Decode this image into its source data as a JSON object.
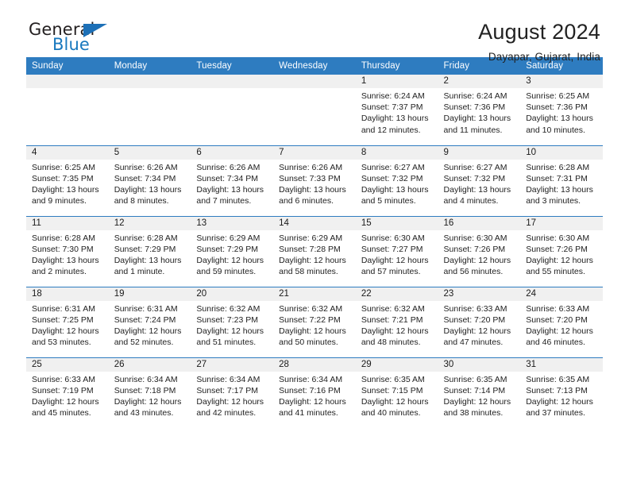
{
  "brand": {
    "line1": "General",
    "line2": "Blue",
    "accent_color": "#1d70b7"
  },
  "header": {
    "title": "August 2024",
    "subtitle": "Dayapar, Gujarat, India"
  },
  "theme": {
    "header_bg": "#2e7cc0",
    "daynum_bg": "#f0f0f0",
    "text": "#222222"
  },
  "weekdays": [
    "Sunday",
    "Monday",
    "Tuesday",
    "Wednesday",
    "Thursday",
    "Friday",
    "Saturday"
  ],
  "labels": {
    "sunrise": "Sunrise:",
    "sunset": "Sunset:",
    "daylight": "Daylight:"
  },
  "weeks": [
    [
      {
        "day": "",
        "sunrise": "",
        "sunset": "",
        "daylight_l1": "",
        "daylight_l2": ""
      },
      {
        "day": "",
        "sunrise": "",
        "sunset": "",
        "daylight_l1": "",
        "daylight_l2": ""
      },
      {
        "day": "",
        "sunrise": "",
        "sunset": "",
        "daylight_l1": "",
        "daylight_l2": ""
      },
      {
        "day": "",
        "sunrise": "",
        "sunset": "",
        "daylight_l1": "",
        "daylight_l2": ""
      },
      {
        "day": "1",
        "sunrise": "Sunrise: 6:24 AM",
        "sunset": "Sunset: 7:37 PM",
        "daylight_l1": "Daylight: 13 hours",
        "daylight_l2": "and 12 minutes."
      },
      {
        "day": "2",
        "sunrise": "Sunrise: 6:24 AM",
        "sunset": "Sunset: 7:36 PM",
        "daylight_l1": "Daylight: 13 hours",
        "daylight_l2": "and 11 minutes."
      },
      {
        "day": "3",
        "sunrise": "Sunrise: 6:25 AM",
        "sunset": "Sunset: 7:36 PM",
        "daylight_l1": "Daylight: 13 hours",
        "daylight_l2": "and 10 minutes."
      }
    ],
    [
      {
        "day": "4",
        "sunrise": "Sunrise: 6:25 AM",
        "sunset": "Sunset: 7:35 PM",
        "daylight_l1": "Daylight: 13 hours",
        "daylight_l2": "and 9 minutes."
      },
      {
        "day": "5",
        "sunrise": "Sunrise: 6:26 AM",
        "sunset": "Sunset: 7:34 PM",
        "daylight_l1": "Daylight: 13 hours",
        "daylight_l2": "and 8 minutes."
      },
      {
        "day": "6",
        "sunrise": "Sunrise: 6:26 AM",
        "sunset": "Sunset: 7:34 PM",
        "daylight_l1": "Daylight: 13 hours",
        "daylight_l2": "and 7 minutes."
      },
      {
        "day": "7",
        "sunrise": "Sunrise: 6:26 AM",
        "sunset": "Sunset: 7:33 PM",
        "daylight_l1": "Daylight: 13 hours",
        "daylight_l2": "and 6 minutes."
      },
      {
        "day": "8",
        "sunrise": "Sunrise: 6:27 AM",
        "sunset": "Sunset: 7:32 PM",
        "daylight_l1": "Daylight: 13 hours",
        "daylight_l2": "and 5 minutes."
      },
      {
        "day": "9",
        "sunrise": "Sunrise: 6:27 AM",
        "sunset": "Sunset: 7:32 PM",
        "daylight_l1": "Daylight: 13 hours",
        "daylight_l2": "and 4 minutes."
      },
      {
        "day": "10",
        "sunrise": "Sunrise: 6:28 AM",
        "sunset": "Sunset: 7:31 PM",
        "daylight_l1": "Daylight: 13 hours",
        "daylight_l2": "and 3 minutes."
      }
    ],
    [
      {
        "day": "11",
        "sunrise": "Sunrise: 6:28 AM",
        "sunset": "Sunset: 7:30 PM",
        "daylight_l1": "Daylight: 13 hours",
        "daylight_l2": "and 2 minutes."
      },
      {
        "day": "12",
        "sunrise": "Sunrise: 6:28 AM",
        "sunset": "Sunset: 7:29 PM",
        "daylight_l1": "Daylight: 13 hours",
        "daylight_l2": "and 1 minute."
      },
      {
        "day": "13",
        "sunrise": "Sunrise: 6:29 AM",
        "sunset": "Sunset: 7:29 PM",
        "daylight_l1": "Daylight: 12 hours",
        "daylight_l2": "and 59 minutes."
      },
      {
        "day": "14",
        "sunrise": "Sunrise: 6:29 AM",
        "sunset": "Sunset: 7:28 PM",
        "daylight_l1": "Daylight: 12 hours",
        "daylight_l2": "and 58 minutes."
      },
      {
        "day": "15",
        "sunrise": "Sunrise: 6:30 AM",
        "sunset": "Sunset: 7:27 PM",
        "daylight_l1": "Daylight: 12 hours",
        "daylight_l2": "and 57 minutes."
      },
      {
        "day": "16",
        "sunrise": "Sunrise: 6:30 AM",
        "sunset": "Sunset: 7:26 PM",
        "daylight_l1": "Daylight: 12 hours",
        "daylight_l2": "and 56 minutes."
      },
      {
        "day": "17",
        "sunrise": "Sunrise: 6:30 AM",
        "sunset": "Sunset: 7:26 PM",
        "daylight_l1": "Daylight: 12 hours",
        "daylight_l2": "and 55 minutes."
      }
    ],
    [
      {
        "day": "18",
        "sunrise": "Sunrise: 6:31 AM",
        "sunset": "Sunset: 7:25 PM",
        "daylight_l1": "Daylight: 12 hours",
        "daylight_l2": "and 53 minutes."
      },
      {
        "day": "19",
        "sunrise": "Sunrise: 6:31 AM",
        "sunset": "Sunset: 7:24 PM",
        "daylight_l1": "Daylight: 12 hours",
        "daylight_l2": "and 52 minutes."
      },
      {
        "day": "20",
        "sunrise": "Sunrise: 6:32 AM",
        "sunset": "Sunset: 7:23 PM",
        "daylight_l1": "Daylight: 12 hours",
        "daylight_l2": "and 51 minutes."
      },
      {
        "day": "21",
        "sunrise": "Sunrise: 6:32 AM",
        "sunset": "Sunset: 7:22 PM",
        "daylight_l1": "Daylight: 12 hours",
        "daylight_l2": "and 50 minutes."
      },
      {
        "day": "22",
        "sunrise": "Sunrise: 6:32 AM",
        "sunset": "Sunset: 7:21 PM",
        "daylight_l1": "Daylight: 12 hours",
        "daylight_l2": "and 48 minutes."
      },
      {
        "day": "23",
        "sunrise": "Sunrise: 6:33 AM",
        "sunset": "Sunset: 7:20 PM",
        "daylight_l1": "Daylight: 12 hours",
        "daylight_l2": "and 47 minutes."
      },
      {
        "day": "24",
        "sunrise": "Sunrise: 6:33 AM",
        "sunset": "Sunset: 7:20 PM",
        "daylight_l1": "Daylight: 12 hours",
        "daylight_l2": "and 46 minutes."
      }
    ],
    [
      {
        "day": "25",
        "sunrise": "Sunrise: 6:33 AM",
        "sunset": "Sunset: 7:19 PM",
        "daylight_l1": "Daylight: 12 hours",
        "daylight_l2": "and 45 minutes."
      },
      {
        "day": "26",
        "sunrise": "Sunrise: 6:34 AM",
        "sunset": "Sunset: 7:18 PM",
        "daylight_l1": "Daylight: 12 hours",
        "daylight_l2": "and 43 minutes."
      },
      {
        "day": "27",
        "sunrise": "Sunrise: 6:34 AM",
        "sunset": "Sunset: 7:17 PM",
        "daylight_l1": "Daylight: 12 hours",
        "daylight_l2": "and 42 minutes."
      },
      {
        "day": "28",
        "sunrise": "Sunrise: 6:34 AM",
        "sunset": "Sunset: 7:16 PM",
        "daylight_l1": "Daylight: 12 hours",
        "daylight_l2": "and 41 minutes."
      },
      {
        "day": "29",
        "sunrise": "Sunrise: 6:35 AM",
        "sunset": "Sunset: 7:15 PM",
        "daylight_l1": "Daylight: 12 hours",
        "daylight_l2": "and 40 minutes."
      },
      {
        "day": "30",
        "sunrise": "Sunrise: 6:35 AM",
        "sunset": "Sunset: 7:14 PM",
        "daylight_l1": "Daylight: 12 hours",
        "daylight_l2": "and 38 minutes."
      },
      {
        "day": "31",
        "sunrise": "Sunrise: 6:35 AM",
        "sunset": "Sunset: 7:13 PM",
        "daylight_l1": "Daylight: 12 hours",
        "daylight_l2": "and 37 minutes."
      }
    ]
  ]
}
